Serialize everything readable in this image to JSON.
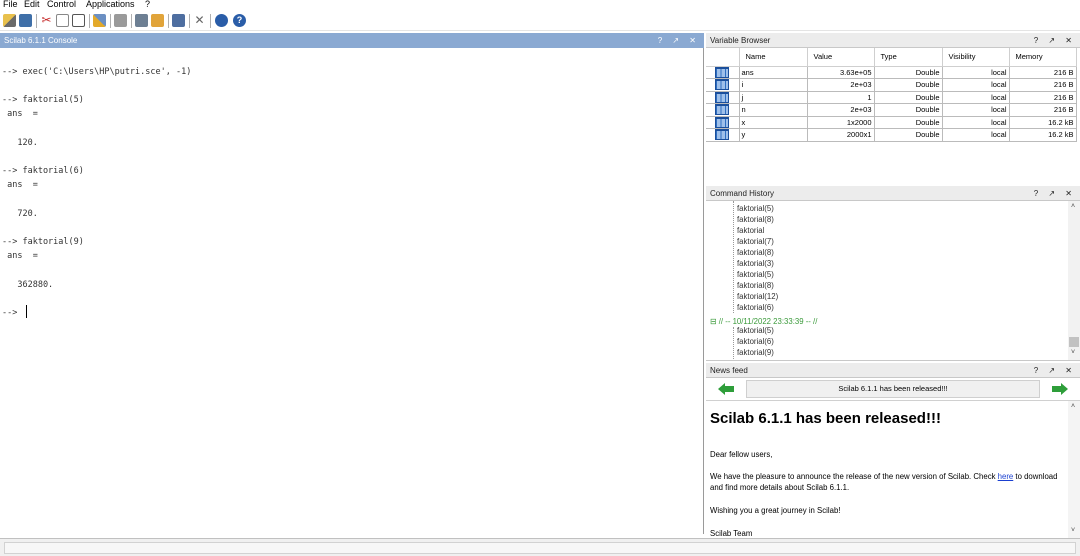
{
  "menubar": {
    "items": [
      "File",
      "Edit",
      "Control",
      "Applications",
      "?"
    ]
  },
  "toolbar": {
    "icons": [
      "new-file-icon",
      "open-file-icon",
      "cut-icon",
      "copy-icon",
      "paste-icon",
      "change-directory-icon",
      "print-icon",
      "applications-icon",
      "demonstrations-icon",
      "tools-icon",
      "module-manager-icon",
      "help-icon"
    ]
  },
  "console": {
    "title": "Scilab 6.1.1 Console",
    "controls": "? ↗ ✕",
    "lines": [
      "--> exec('C:\\Users\\HP\\putri.sce', -1)",
      "--> faktorial(5)",
      " ans  =",
      "   120.",
      "--> faktorial(6)",
      " ans  =",
      "   720.",
      "--> faktorial(9)",
      " ans  =",
      "   362880.",
      "--> "
    ]
  },
  "variable_browser": {
    "title": "Variable Browser",
    "controls": "? ↗ ✕",
    "columns": [
      "Name",
      "Value",
      "Type",
      "Visibility",
      "Memory"
    ],
    "rows": [
      {
        "name": "ans",
        "value": "3.63e+05",
        "type": "Double",
        "visibility": "local",
        "memory": "216 B"
      },
      {
        "name": "i",
        "value": "2e+03",
        "type": "Double",
        "visibility": "local",
        "memory": "216 B"
      },
      {
        "name": "j",
        "value": "1",
        "type": "Double",
        "visibility": "local",
        "memory": "216 B"
      },
      {
        "name": "n",
        "value": "2e+03",
        "type": "Double",
        "visibility": "local",
        "memory": "216 B"
      },
      {
        "name": "x",
        "value": "1x2000",
        "type": "Double",
        "visibility": "local",
        "memory": "16.2 kB"
      },
      {
        "name": "y",
        "value": "2000x1",
        "type": "Double",
        "visibility": "local",
        "memory": "16.2 kB"
      }
    ]
  },
  "command_history": {
    "title": "Command History",
    "controls": "? ↗ ✕",
    "items_before": [
      "faktorial(5)",
      "faktorial(8)",
      "faktorial",
      "faktorial(7)",
      "faktorial(8)",
      "faktorial(3)",
      "faktorial(5)",
      "faktorial(8)",
      "faktorial(12)",
      "faktorial(6)"
    ],
    "session": "// -- 10/11/2022 23:33:39 -- //",
    "items_after": [
      "faktorial(5)",
      "faktorial(6)",
      "faktorial(9)"
    ]
  },
  "news_feed": {
    "title": "News feed",
    "controls": "? ↗ ✕",
    "headline_bar": "Scilab 6.1.1 has been released!!!",
    "heading": "Scilab 6.1.1 has been released!!!",
    "p1": "Dear fellow users,",
    "p2a": "We have the pleasure to announce the release of the new version of Scilab. Check ",
    "link": "here",
    "p2b": " to download and find more details about Scilab 6.1.1.",
    "p3": "Wishing you a great journey in Scilab!",
    "p4": "Scilab Team"
  },
  "colors": {
    "console_title_bg": "#8aa9d2",
    "session_green": "#3a9a3a",
    "link_blue": "#1a3fd0",
    "nav_arrow_green": "#2e9e3a"
  }
}
